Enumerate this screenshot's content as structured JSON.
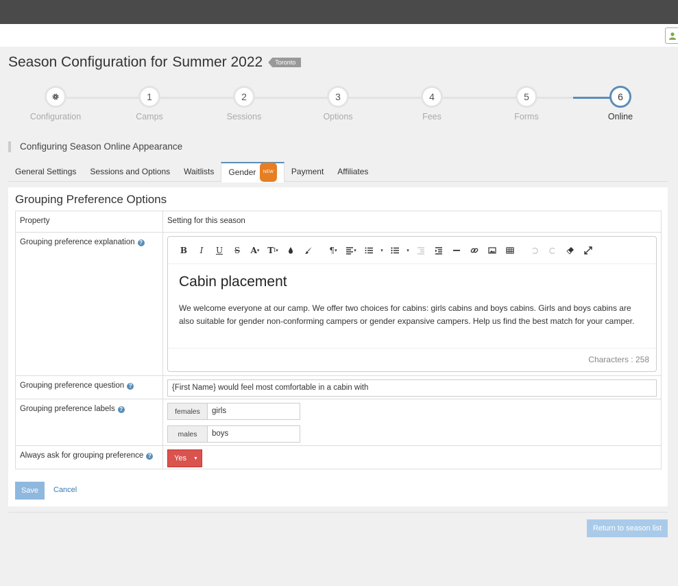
{
  "header": {
    "title_prefix": "Season Configuration for",
    "season_name": "Summer 2022",
    "location_badge": "Toronto"
  },
  "steps": [
    {
      "number": "",
      "label": "Configuration",
      "icon": "gear-icon",
      "active": false
    },
    {
      "number": "1",
      "label": "Camps",
      "active": false
    },
    {
      "number": "2",
      "label": "Sessions",
      "active": false
    },
    {
      "number": "3",
      "label": "Options",
      "active": false
    },
    {
      "number": "4",
      "label": "Fees",
      "active": false
    },
    {
      "number": "5",
      "label": "Forms",
      "active": false
    },
    {
      "number": "6",
      "label": "Online",
      "active": true
    }
  ],
  "section_heading": "Configuring Season Online Appearance",
  "tabs": [
    {
      "label": "General Settings"
    },
    {
      "label": "Sessions and Options"
    },
    {
      "label": "Waitlists"
    },
    {
      "label": "Gender",
      "badge": "NEW",
      "active": true
    },
    {
      "label": "Payment"
    },
    {
      "label": "Affiliates"
    }
  ],
  "panel": {
    "title": "Grouping Preference Options",
    "col_property": "Property",
    "col_setting": "Setting for this season",
    "rows": {
      "explanation_label": "Grouping preference explanation",
      "question_label": "Grouping preference question",
      "labels_label": "Grouping preference labels",
      "always_ask_label": "Always ask for grouping preference"
    },
    "editor": {
      "heading": "Cabin placement",
      "body": "We welcome everyone at our camp. We offer two choices for cabins: girls cabins and boys cabins. Girls and boys cabins are also suitable for gender non-conforming campers or gender expansive campers. Help us find the best match for your camper.",
      "char_count": "Characters : 258"
    },
    "question_value": "{First Name} would feel most comfortable in a cabin with",
    "labels": [
      {
        "key": "females",
        "value": "girls"
      },
      {
        "key": "males",
        "value": "boys"
      }
    ],
    "always_ask_value": "Yes",
    "save_label": "Save",
    "cancel_label": "Cancel"
  },
  "return_label": "Return to season list",
  "colors": {
    "accent": "#5b8db8",
    "danger": "#d9534f",
    "badge_new": "#e67e22"
  }
}
